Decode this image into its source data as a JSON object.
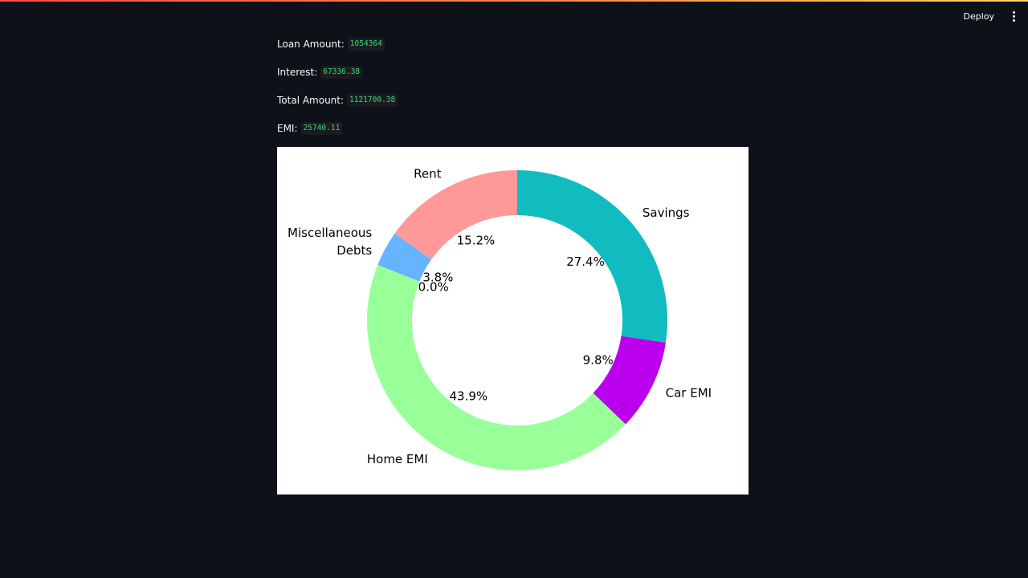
{
  "header": {
    "deploy_label": "Deploy",
    "menu_icon": "vertical-dots-icon"
  },
  "metrics": [
    {
      "label": "Loan Amount:",
      "value": "1054364"
    },
    {
      "label": "Interest:",
      "value": "67336.38"
    },
    {
      "label": "Total Amount:",
      "value": "1121700.38"
    },
    {
      "label": "EMI:",
      "value": "25740.11"
    }
  ],
  "chart_data": {
    "type": "pie",
    "donut": true,
    "start_angle": 90,
    "direction": "counterclockwise",
    "slices": [
      {
        "label": "Rent",
        "percent": 15.2,
        "pct_label": "15.2%",
        "color": "#ff9999"
      },
      {
        "label": "Miscellaneous\nDebts",
        "percent": 3.8,
        "pct_label": "3.8%",
        "color": "#66b3ff"
      },
      {
        "label": "",
        "percent": 0.0,
        "pct_label": "0.0%",
        "color": "#66b3ff"
      },
      {
        "label": "Home EMI",
        "percent": 43.9,
        "pct_label": "43.9%",
        "color": "#99ff99"
      },
      {
        "label": "Car EMI",
        "percent": 9.8,
        "pct_label": "9.8%",
        "color": "#bb00ee"
      },
      {
        "label": "Savings",
        "percent": 27.4,
        "pct_label": "27.4%",
        "color": "#10bcc0"
      }
    ]
  }
}
